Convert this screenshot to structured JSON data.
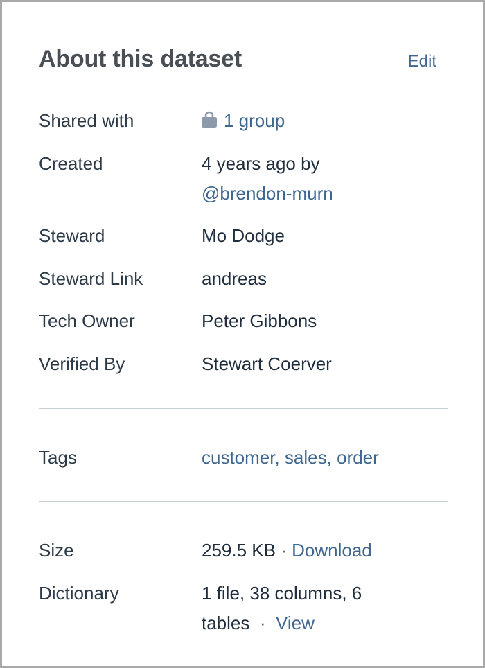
{
  "header": {
    "title": "About this dataset",
    "edit_label": "Edit"
  },
  "details": {
    "shared_with": {
      "label": "Shared with",
      "value": "1 group",
      "icon": "lock-icon"
    },
    "created": {
      "label": "Created",
      "value": "4 years ago by",
      "user": "@brendon-murn"
    },
    "steward": {
      "label": "Steward",
      "value": "Mo Dodge"
    },
    "steward_link": {
      "label": "Steward Link",
      "value": "andreas"
    },
    "tech_owner": {
      "label": "Tech Owner",
      "value": "Peter Gibbons"
    },
    "verified_by": {
      "label": "Verified By",
      "value": "Stewart Coerver"
    }
  },
  "tags": {
    "label": "Tags",
    "value": "customer, sales, order"
  },
  "files": {
    "size": {
      "label": "Size",
      "value": "259.5 KB",
      "separator": "·",
      "action": "Download"
    },
    "dictionary": {
      "label": "Dictionary",
      "value_line1": "1 file, 38 columns, 6",
      "value_line2": "tables",
      "separator": "·",
      "action": "View"
    }
  },
  "colors": {
    "link": "#3d6790",
    "text": "#1f2d3d",
    "title": "#4a4f55",
    "divider": "#c8ced5",
    "icon": "#8c9aab"
  }
}
